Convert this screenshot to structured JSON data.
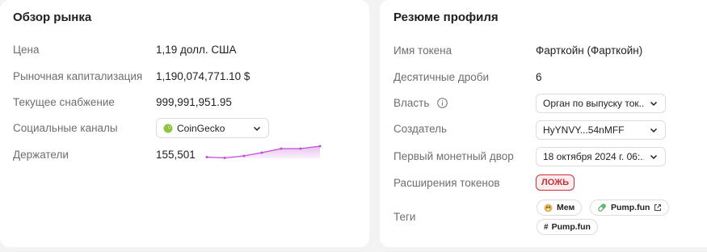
{
  "market_overview": {
    "title": "Обзор рынка",
    "price_label": "Цена",
    "price_value": "1,19 долл. США",
    "market_cap_label": "Рыночная капитализация",
    "market_cap_value": "1,190,074,771.10 $",
    "supply_label": "Текущее снабжение",
    "supply_value": "999,991,951.95",
    "social_label": "Социальные каналы",
    "social_selected": "CoinGecko",
    "holders_label": "Держатели",
    "holders_value": "155,501"
  },
  "profile_summary": {
    "title": "Резюме профиля",
    "token_name_label": "Имя токена",
    "token_name_value": "Фарткойн (Фарткойн)",
    "decimals_label": "Десятичные дроби",
    "decimals_value": "6",
    "authority_label": "Власть",
    "authority_selected": "Орган по выпуску ток...",
    "creator_label": "Создатель",
    "creator_selected": "HyYNVY...54nMFF",
    "first_mint_label": "Первый монетный двор",
    "first_mint_selected": "18 октября 2024 г. 06:...",
    "extensions_label": "Расширения токенов",
    "extensions_value": "ЛОЖЬ",
    "tags_label": "Теги",
    "tags": [
      "Мем",
      "Pump.fun",
      "Pump.fun"
    ]
  },
  "colors": {
    "sparkline": "#c04fd6",
    "false_badge": "#c9303a",
    "coingecko_green": "#8dc63f"
  }
}
